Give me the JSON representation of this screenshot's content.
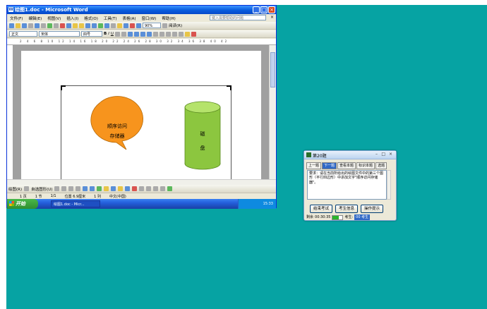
{
  "word": {
    "title": "绘图1.doc - Microsoft Word",
    "menu": [
      "文件(F)",
      "编辑(E)",
      "视图(V)",
      "插入(I)",
      "格式(O)",
      "工具(T)",
      "表格(A)",
      "窗口(W)",
      "帮助(H)"
    ],
    "help_placeholder": "键入需要帮助的问题",
    "toolbar": {
      "zoom": "90%",
      "read": "阅读(R)"
    },
    "format": {
      "style": "正文",
      "font": "宋体",
      "size": "四号",
      "bold": "B",
      "italic": "I",
      "underline": "U"
    },
    "ruler_numbers": "2 4 6 8 10 12 14 16 18 20 22 24 26 28 30 32 34 36 38 40 42",
    "shapes": {
      "callout_line1": "顺序访问",
      "callout_line2": "存储器",
      "cylinder_line1": "磁",
      "cylinder_line2": "盘"
    },
    "drawbar": {
      "draw": "绘图(R)",
      "autoshape": "自选图形(U)"
    },
    "status": {
      "page": "1 页",
      "section": "1 节",
      "pages": "1/1",
      "position": "位置 6.9厘米",
      "line": "1 列",
      "lang": "中文(中国)"
    },
    "taskbar": {
      "start": "开始",
      "item": "绘图1.doc - Micr...",
      "clock": "15:33"
    },
    "colors": {
      "callout": "#f7941d",
      "cylinder": "#8cc63f",
      "desktop": "#06a3a3"
    }
  },
  "exam": {
    "title": "第20题",
    "tabs": [
      "上一题",
      "下一题",
      "查看本题",
      "标识本题",
      "选题"
    ],
    "question": "要求：请在当前所给出的绘图文件中的第三个图形（平行四边形）中添加文字\"顺序访问存储器\"。",
    "buttons": [
      "结束考试",
      "考生信息",
      "操作提示"
    ],
    "status": {
      "time_label": "剩余",
      "time": "00:30:35",
      "progress": 0.6,
      "candidate_label": "考生:",
      "candidate_id": "00 考生"
    }
  }
}
